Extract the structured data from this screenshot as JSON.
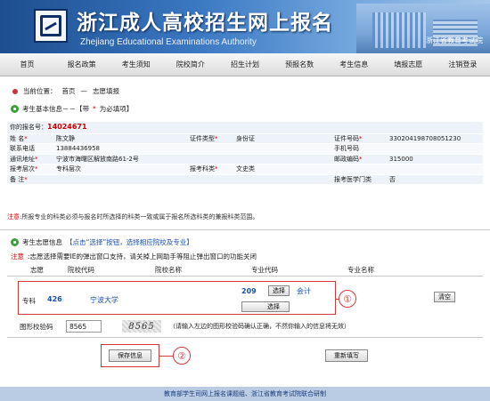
{
  "header": {
    "title": "浙江成人高校招生网上报名",
    "subtitle": "Zhejiang Educational Examinations Authority",
    "org": "浙江省教育考试院"
  },
  "nav": [
    "首页",
    "报名政策",
    "考生须知",
    "院校简介",
    "招生计划",
    "预报名数",
    "考生信息",
    "填报志愿",
    "注销登录"
  ],
  "breadcrumb": {
    "prefix": "当前位置：",
    "home": "首页",
    "sep": "—",
    "current": "志愿填报"
  },
  "basic": {
    "heading": "考生基本信息－－【带",
    "star": "*",
    "heading_tail": "为必填项】",
    "reg_label": "你的报名号：",
    "reg_no": "14024671",
    "rows": [
      [
        "姓 名",
        "陈文静",
        "证件类型",
        "身份证",
        "证件号码",
        "330204198708051230"
      ],
      [
        "联系电话",
        "13884436958",
        "",
        "",
        "手机号码",
        ""
      ],
      [
        "通讯地址",
        "宁波市海曙区解放南路61-2号",
        "",
        "",
        "邮政编码",
        "315000"
      ],
      [
        "报考层次",
        "专科层次",
        "报考科类",
        "文史类",
        "",
        ""
      ],
      [
        "备 注",
        "",
        "",
        "",
        "报考医学门类",
        "否"
      ]
    ],
    "required": [
      true,
      false,
      true,
      true,
      true
    ],
    "required_col2": [
      true,
      false,
      false,
      true,
      false
    ],
    "required_col3": [
      true,
      false,
      true,
      false,
      false
    ],
    "note_label": "注意",
    "note": ":所报专业的科类必须与报名时所选择的科类一致或属于报名所选科类的兼报科类范围。"
  },
  "choices": {
    "heading": "考生志愿信息",
    "heading_tip": "【点击“选择”按钮，选择相应院校及专业】",
    "note_label": "注意",
    "note": ":志愿选择需要IE的弹出窗口支持，请关掉上网助手等阻止弹出窗口的功能关闭",
    "columns": [
      "志愿",
      "院校代码",
      "院校名称",
      "专业代码",
      "专业名称"
    ],
    "row": {
      "label": "专科",
      "school_code": "426",
      "school_name": "宁波大学",
      "major_code": "209",
      "major_name": "会计",
      "select_label": "选择",
      "clear_label": "清空"
    },
    "callout_1": "①",
    "callout_2": "②"
  },
  "verify": {
    "label": "图形校验码",
    "value": "8565",
    "captcha": "8565",
    "hint": "（请输入左边的图形校验码确认正确，不然你输入的信息将无效）"
  },
  "actions": {
    "save": "保存信息",
    "reset": "重新填写"
  },
  "footer": "教育部学生司网上报名课题组、浙江省教育考试院联合研制"
}
